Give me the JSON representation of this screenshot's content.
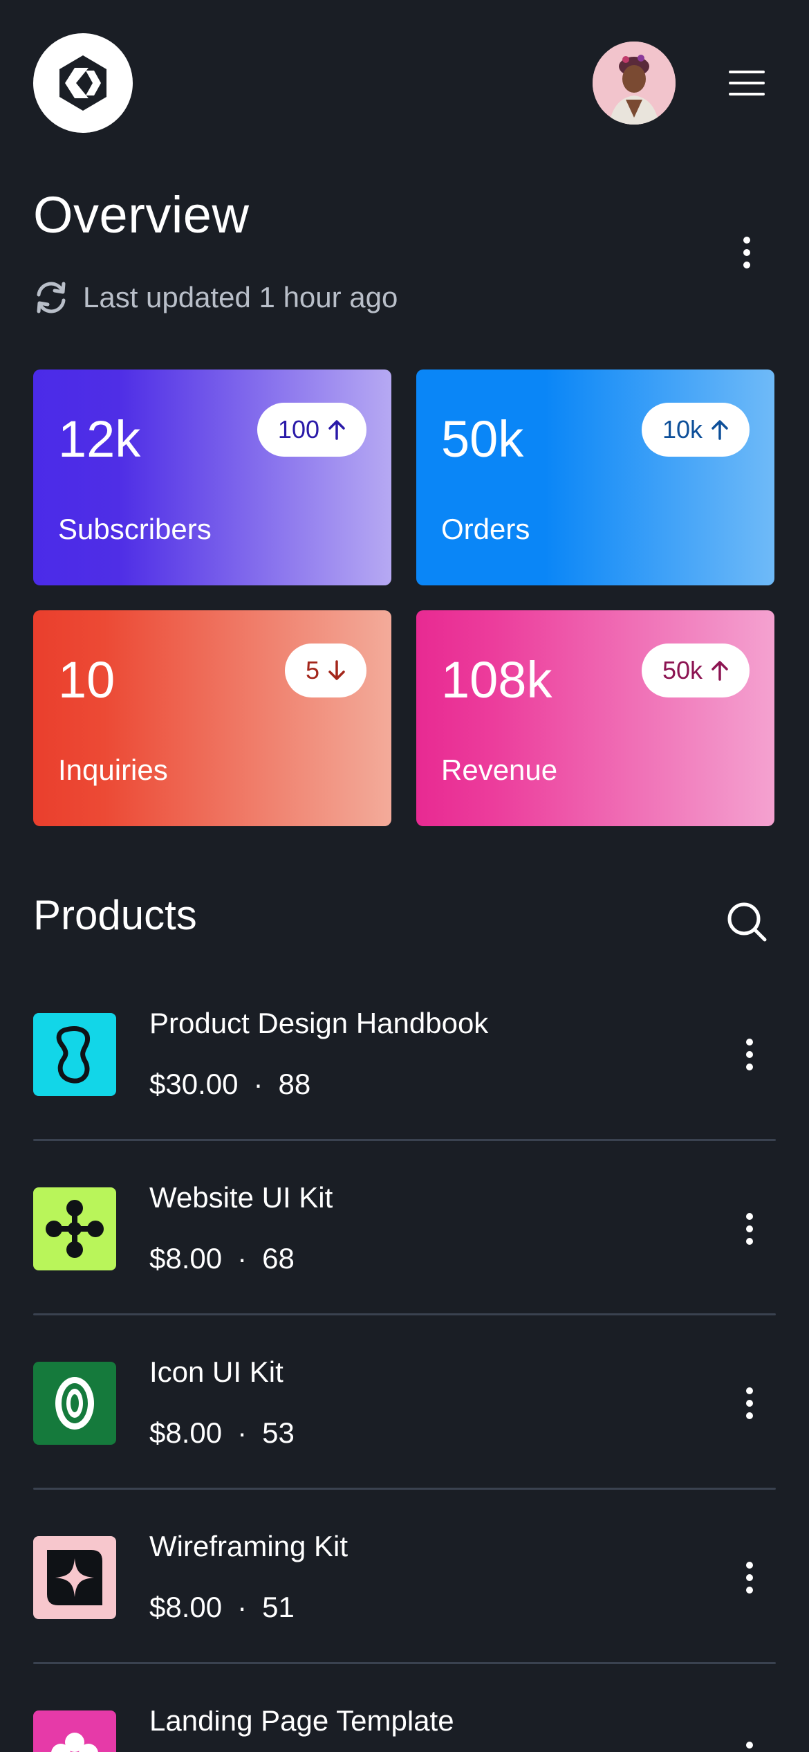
{
  "header": {
    "logo_icon": "hexagon-logo-icon",
    "avatar_icon": "user-avatar",
    "menu_icon": "hamburger-menu-icon"
  },
  "overview": {
    "title": "Overview",
    "more_icon": "vertical-dots-icon",
    "updated_icon": "refresh-icon",
    "updated_text": "Last updated 1 hour ago"
  },
  "stats": [
    {
      "value": "12k",
      "label": "Subscribers",
      "badge": "100",
      "trend": "up",
      "trend_icon": "arrow-up-icon",
      "accent": "#4b2be8"
    },
    {
      "value": "50k",
      "label": "Orders",
      "badge": "10k",
      "trend": "up",
      "trend_icon": "arrow-up-icon",
      "accent": "#0a86f7"
    },
    {
      "value": "10",
      "label": "Inquiries",
      "badge": "5",
      "trend": "down",
      "trend_icon": "arrow-down-icon",
      "accent": "#ea3f2d"
    },
    {
      "value": "108k",
      "label": "Revenue",
      "badge": "50k",
      "trend": "up",
      "trend_icon": "arrow-up-icon",
      "accent": "#e82a92"
    }
  ],
  "products": {
    "title": "Products",
    "search_icon": "search-icon",
    "items": [
      {
        "name": "Product Design Handbook",
        "price": "$30.00",
        "separator": "·",
        "count": "88",
        "thumb_color": "#12d6e8",
        "thumb_icon": "blob-icon"
      },
      {
        "name": "Website UI Kit",
        "price": "$8.00",
        "separator": "·",
        "count": "68",
        "thumb_color": "#b9f55a",
        "thumb_icon": "nodes-icon"
      },
      {
        "name": "Icon UI Kit",
        "price": "$8.00",
        "separator": "·",
        "count": "53",
        "thumb_color": "#157a3c",
        "thumb_icon": "zero-ring-icon"
      },
      {
        "name": "Wireframing Kit",
        "price": "$8.00",
        "separator": "·",
        "count": "51",
        "thumb_color": "#f7c7cd",
        "thumb_icon": "sparkle-square-icon"
      },
      {
        "name": "Landing Page Template",
        "price": "",
        "separator": "",
        "count": "",
        "thumb_color": "#e63aa8",
        "thumb_icon": "flower-icon"
      }
    ]
  }
}
